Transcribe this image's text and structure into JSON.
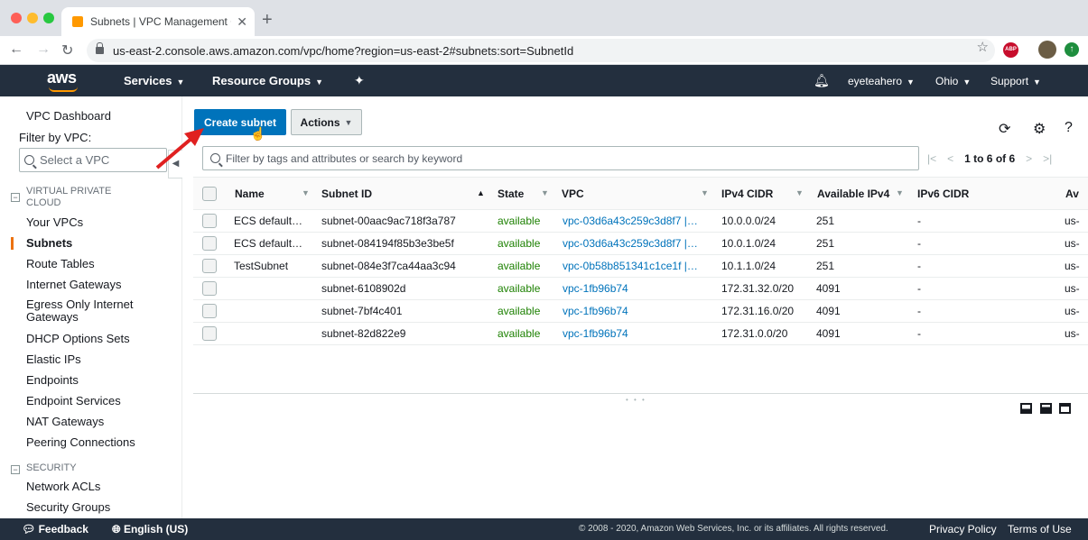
{
  "browser": {
    "tab_title": "Subnets | VPC Management Co",
    "tab_close": "✕",
    "new_tab": "+",
    "url": "us-east-2.console.aws.amazon.com/vpc/home?region=us-east-2#subnets:sort=SubnetId",
    "abp_label": "ABP"
  },
  "awsnav": {
    "logo": "aws",
    "services": "Services",
    "resource_groups": "Resource Groups",
    "user": "eyeteahero",
    "region": "Ohio",
    "support": "Support"
  },
  "sidebar": {
    "dashboard": "VPC Dashboard",
    "filter_label": "Filter by VPC:",
    "select_placeholder": "Select a VPC",
    "section_vpc": "VIRTUAL PRIVATE CLOUD",
    "items_vpc": [
      "Your VPCs",
      "Subnets",
      "Route Tables",
      "Internet Gateways",
      "Egress Only Internet Gateways",
      "DHCP Options Sets",
      "Elastic IPs",
      "Endpoints",
      "Endpoint Services",
      "NAT Gateways",
      "Peering Connections"
    ],
    "section_security": "SECURITY",
    "items_security": [
      "Network ACLs",
      "Security Groups"
    ]
  },
  "toolbar": {
    "create_label": "Create subnet",
    "actions_label": "Actions"
  },
  "filter": {
    "placeholder": "Filter by tags and attributes or search by keyword"
  },
  "pager": {
    "text": "1 to 6 of 6"
  },
  "table": {
    "columns": [
      "Name",
      "Subnet ID",
      "State",
      "VPC",
      "IPv4 CIDR",
      "Available IPv4",
      "IPv6 CIDR",
      "Av"
    ],
    "rows": [
      {
        "name": "ECS default…",
        "subnet_id": "subnet-00aac9ac718f3a787",
        "state": "available",
        "vpc": "vpc-03d6a43c259c3d8f7 |…",
        "ipv4": "10.0.0.0/24",
        "avail": "251",
        "ipv6": "-",
        "az": "us-"
      },
      {
        "name": "ECS default…",
        "subnet_id": "subnet-084194f85b3e3be5f",
        "state": "available",
        "vpc": "vpc-03d6a43c259c3d8f7 |…",
        "ipv4": "10.0.1.0/24",
        "avail": "251",
        "ipv6": "-",
        "az": "us-"
      },
      {
        "name": "TestSubnet",
        "subnet_id": "subnet-084e3f7ca44aa3c94",
        "state": "available",
        "vpc": "vpc-0b58b851341c1ce1f |…",
        "ipv4": "10.1.1.0/24",
        "avail": "251",
        "ipv6": "-",
        "az": "us-"
      },
      {
        "name": "",
        "subnet_id": "subnet-6108902d",
        "state": "available",
        "vpc": "vpc-1fb96b74",
        "ipv4": "172.31.32.0/20",
        "avail": "4091",
        "ipv6": "-",
        "az": "us-"
      },
      {
        "name": "",
        "subnet_id": "subnet-7bf4c401",
        "state": "available",
        "vpc": "vpc-1fb96b74",
        "ipv4": "172.31.16.0/20",
        "avail": "4091",
        "ipv6": "-",
        "az": "us-"
      },
      {
        "name": "",
        "subnet_id": "subnet-82d822e9",
        "state": "available",
        "vpc": "vpc-1fb96b74",
        "ipv4": "172.31.0.0/20",
        "avail": "4091",
        "ipv6": "-",
        "az": "us-"
      }
    ]
  },
  "footer": {
    "feedback": "Feedback",
    "language": "English (US)",
    "copyright": "© 2008 - 2020, Amazon Web Services, Inc. or its affiliates. All rights reserved.",
    "privacy": "Privacy Policy",
    "terms": "Terms of Use"
  },
  "colors": {
    "aws_nav": "#232f3e",
    "primary_button": "#0073bb",
    "state_available": "#1d8102",
    "accent": "#ec7211",
    "annotation_arrow": "#e02020"
  }
}
